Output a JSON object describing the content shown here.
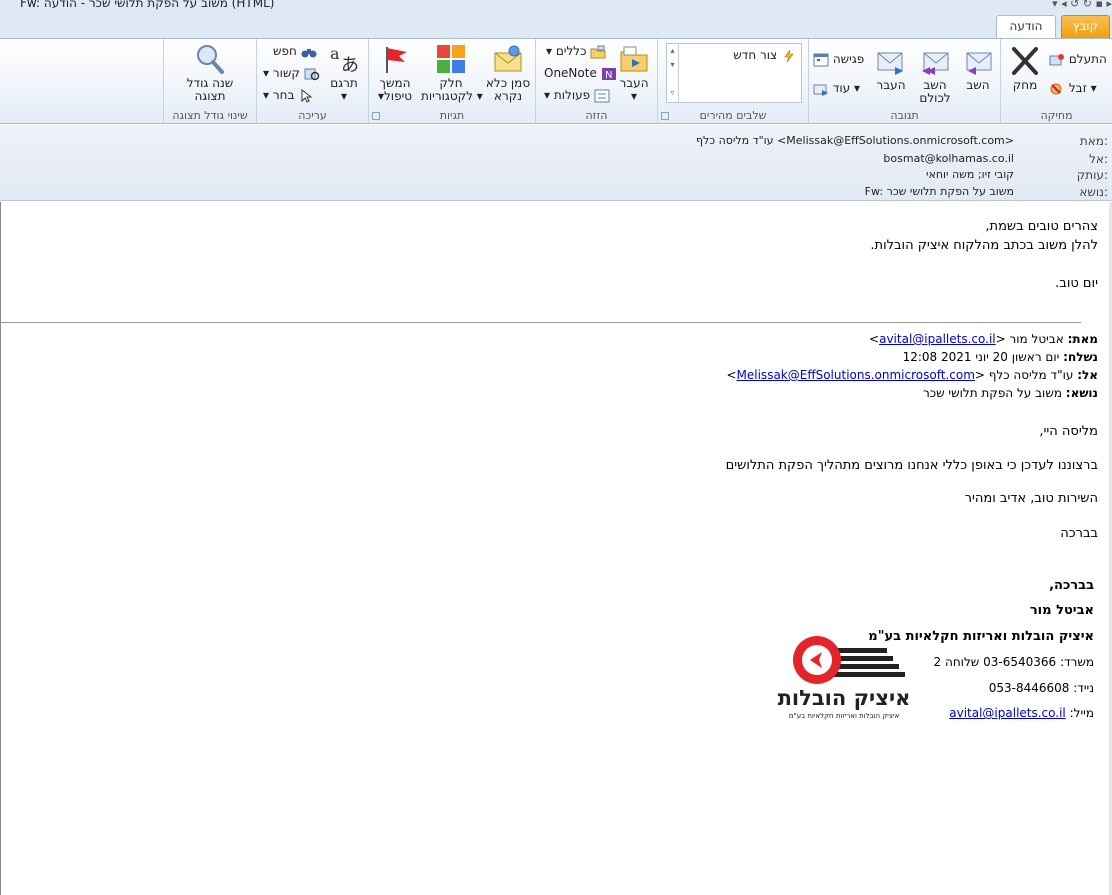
{
  "window": {
    "title": "Fw: משוב על הפקת תלושי שכר - הודעה (HTML)"
  },
  "tabs": {
    "file": "קובץ",
    "message": "הודעה"
  },
  "ribbon": {
    "groups": {
      "delete": "מחיקה",
      "respond": "תגובה",
      "quick_steps": "שלבים מהירים",
      "move": "הזזה",
      "tags": "תגיות",
      "editing": "עריכה",
      "zoom": "שינוי גודל תצוגה"
    },
    "delete": {
      "ignore": "התעלם",
      "junk": "זבל",
      "delete": "מחק"
    },
    "respond": {
      "reply": "השב",
      "reply_all_1": "השב",
      "reply_all_2": "לכולם",
      "forward": "העבר",
      "meeting": "פגישה",
      "more": "עוד"
    },
    "quick_steps": {
      "new": "צור חדש"
    },
    "move": {
      "move_1": "העבר",
      "rules": "כללים",
      "onenote": "OneNote",
      "actions": "פעולות"
    },
    "tags": {
      "mark_unread_1": "סמן כלא",
      "mark_unread_2": "נקרא",
      "categorize_1": "חלק",
      "categorize_2": "לקטגוריות",
      "followup_1": "המשך",
      "followup_2": "טיפול"
    },
    "editing": {
      "translate": "תרגם",
      "find": "חפש",
      "related": "קשור",
      "select": "בחר"
    },
    "zoom": {
      "zoom_1": "שנה גודל",
      "zoom_2": "תצוגה"
    }
  },
  "header": {
    "from_label": "מאת:",
    "to_label": "אל:",
    "cc_label": "עותק:",
    "subject_label": "נושא:",
    "from_value": "עו\"ד מליסה כלף <Melissak@EffSolutions.onmicrosoft.com>",
    "to_value": "bosmat@kolhamas.co.il",
    "cc_value": "קובי זיו; משה יוחאי",
    "subject_value": "Fw: משוב על הפקת תלושי שכר"
  },
  "body": {
    "greeting": "צהרים טובים בשמת,",
    "intro": "להלן משוב בכתב מהלקוח איציק הובלות.",
    "closing": "יום טוב.",
    "fwd": {
      "from_label": "מאת:",
      "from_name": "אביטל מור <",
      "from_email": "avital@ipallets.co.il",
      "from_end": ">",
      "sent_label": "נשלח:",
      "sent_value": "יום ראשון 20 יוני 2021 12:08",
      "to_label": "אל:",
      "to_name": "עו\"ד מליסה כלף <",
      "to_email": "Melissak@EffSolutions.onmicrosoft.com",
      "to_end": ">",
      "subject_label": "נושא:",
      "subject_value": "משוב על הפקת תלושי שכר"
    },
    "p1": "מליסה היי,",
    "p2": "ברצוננו לעדכן כי באופן כללי אנחנו מרוצים מתהליך הפקת התלושים",
    "p3": "השירות טוב, אדיב ומהיר",
    "p4": "בברכה",
    "sig": {
      "regards": "בברכה,",
      "name": "אביטל מור",
      "company": "איציק הובלות ואריזות חקלאיות בע\"מ",
      "office_label": "משרד:",
      "office_value": "03-6540366  שלוחה 2",
      "mobile_label": "נייד:",
      "mobile_value": "053-8446608",
      "mail_label": "מייל:",
      "mail_value": "avital@ipallets.co.il",
      "logo_text": "איציק הובלות",
      "logo_sub": "איציק הובלות ואריזות חקלאיות בע\"מ"
    }
  },
  "colors": {
    "file_tab": "#f0a10a",
    "link": "#0000cc",
    "logo_red": "#e3242b"
  }
}
